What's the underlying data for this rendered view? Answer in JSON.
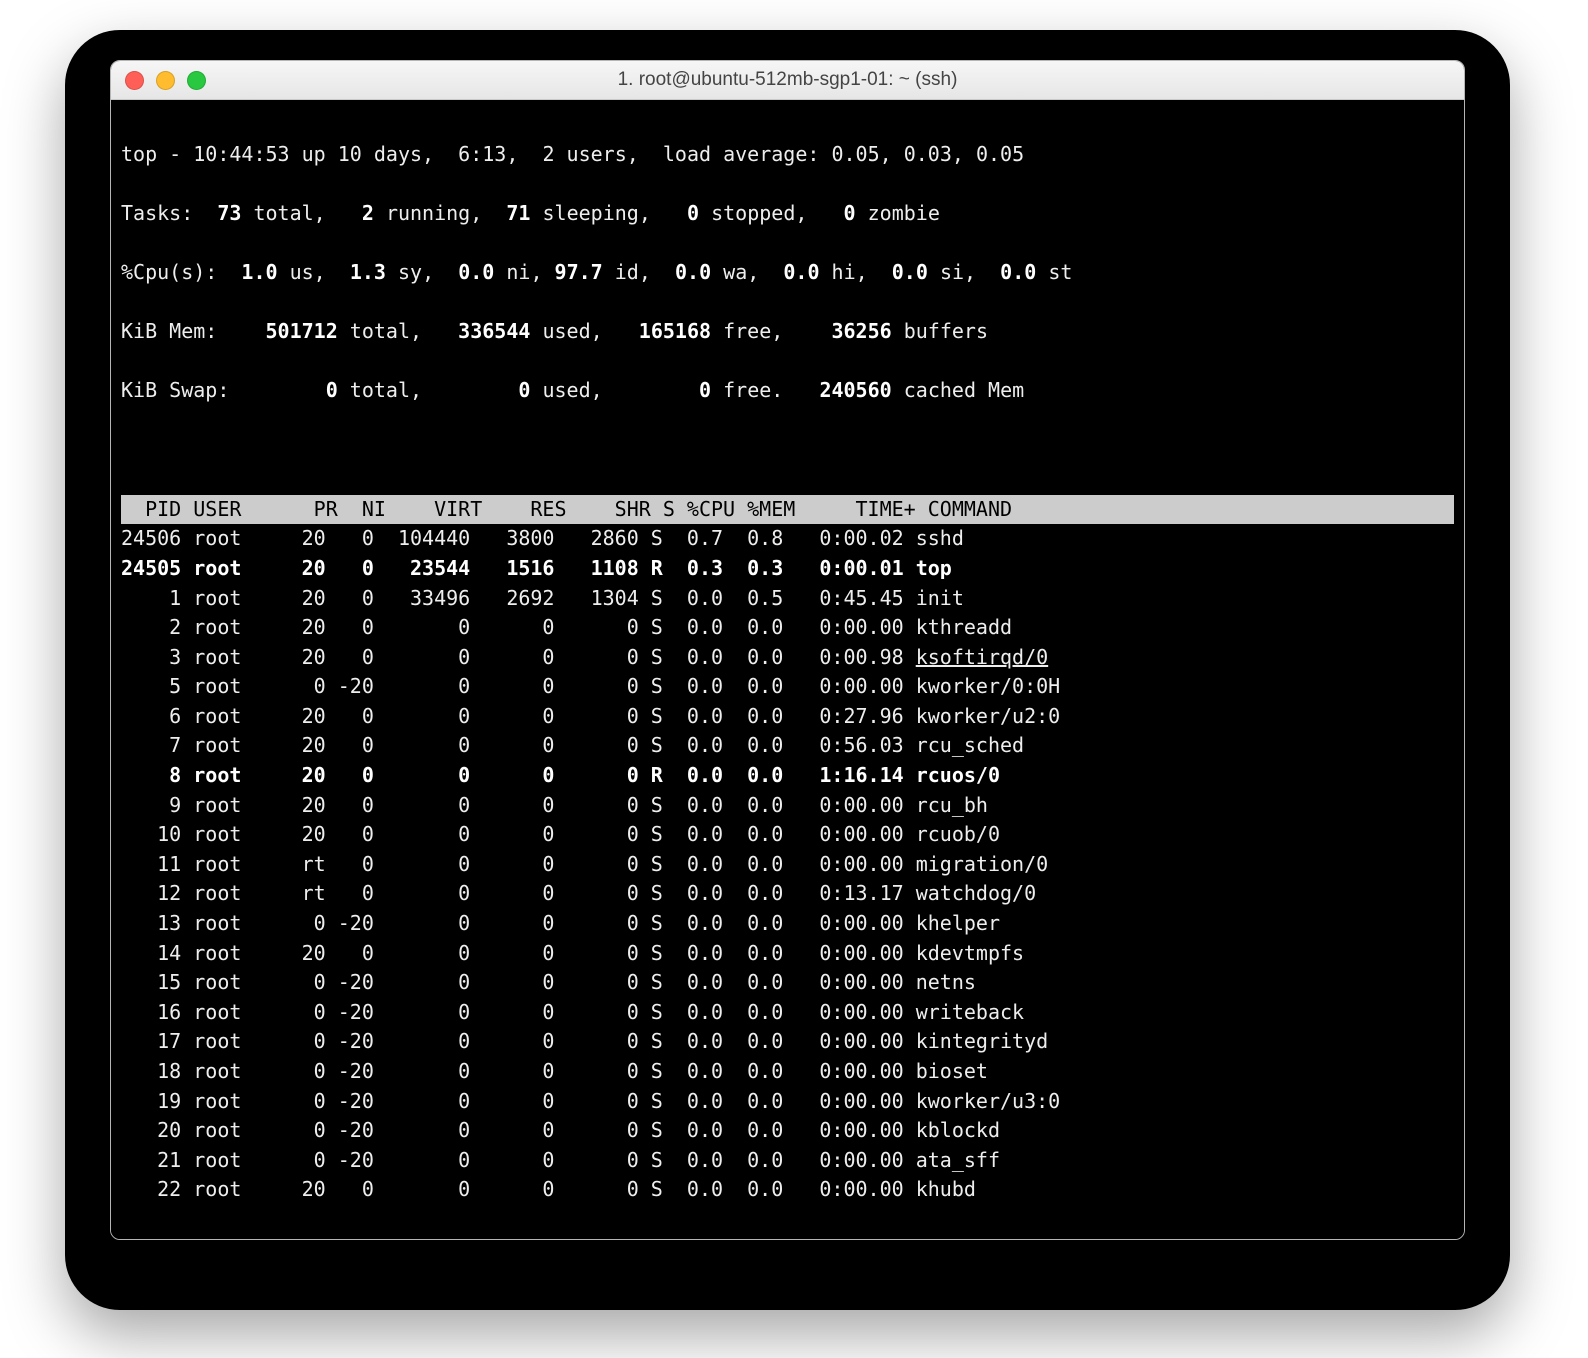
{
  "window": {
    "title": "1. root@ubuntu-512mb-sgp1-01: ~ (ssh)"
  },
  "summary": {
    "prefix": "top - ",
    "time": "10:44:53",
    "uptime_label": " up 10 days,  6:13,  ",
    "users": "2 users",
    "load_label": ",  load average: ",
    "load": "0.05, 0.03, 0.05",
    "tasks_label": "Tasks: ",
    "tasks_total": " 73 ",
    "tasks_total_suffix": "total,   ",
    "tasks_running": "2 ",
    "tasks_running_suffix": "running,  ",
    "tasks_sleeping": "71 ",
    "tasks_sleeping_suffix": "sleeping,   ",
    "tasks_stopped": "0 ",
    "tasks_stopped_suffix": "stopped,   ",
    "tasks_zombie": "0 ",
    "tasks_zombie_suffix": "zombie",
    "cpu_label": "%Cpu(s):  ",
    "cpu_us": "1.0 ",
    "cpu_us_s": "us,  ",
    "cpu_sy": "1.3 ",
    "cpu_sy_s": "sy,  ",
    "cpu_ni": "0.0 ",
    "cpu_ni_s": "ni, ",
    "cpu_id": "97.7 ",
    "cpu_id_s": "id,  ",
    "cpu_wa": "0.0 ",
    "cpu_wa_s": "wa,  ",
    "cpu_hi": "0.0 ",
    "cpu_hi_s": "hi,  ",
    "cpu_si": "0.0 ",
    "cpu_si_s": "si,  ",
    "cpu_st": "0.0 ",
    "cpu_st_s": "st",
    "mem_label": "KiB Mem:    ",
    "mem_total": "501712 ",
    "mem_total_s": "total,   ",
    "mem_used": "336544 ",
    "mem_used_s": "used,   ",
    "mem_free": "165168 ",
    "mem_free_s": "free,    ",
    "mem_buffers": "36256 ",
    "mem_buffers_s": "buffers",
    "swap_label": "KiB Swap:        ",
    "swap_total": "0 ",
    "swap_total_s": "total,        ",
    "swap_used": "0 ",
    "swap_used_s": "used,        ",
    "swap_free": "0 ",
    "swap_free_s": "free.   ",
    "swap_cached": "240560 ",
    "swap_cached_s": "cached Mem"
  },
  "columns": "  PID USER      PR  NI    VIRT    RES    SHR S %CPU %MEM     TIME+ COMMAND              ",
  "rows": [
    {
      "pid": "24506",
      "user": "root",
      "pr": "20",
      "ni": "0",
      "virt": "104440",
      "res": "3800",
      "shr": "2860",
      "s": "S",
      "cpu": "0.7",
      "mem": "0.8",
      "time": "0:00.02",
      "cmd": "sshd",
      "bold": false,
      "underline": false
    },
    {
      "pid": "24505",
      "user": "root",
      "pr": "20",
      "ni": "0",
      "virt": "23544",
      "res": "1516",
      "shr": "1108",
      "s": "R",
      "cpu": "0.3",
      "mem": "0.3",
      "time": "0:00.01",
      "cmd": "top",
      "bold": true,
      "underline": false
    },
    {
      "pid": "1",
      "user": "root",
      "pr": "20",
      "ni": "0",
      "virt": "33496",
      "res": "2692",
      "shr": "1304",
      "s": "S",
      "cpu": "0.0",
      "mem": "0.5",
      "time": "0:45.45",
      "cmd": "init",
      "bold": false,
      "underline": false
    },
    {
      "pid": "2",
      "user": "root",
      "pr": "20",
      "ni": "0",
      "virt": "0",
      "res": "0",
      "shr": "0",
      "s": "S",
      "cpu": "0.0",
      "mem": "0.0",
      "time": "0:00.00",
      "cmd": "kthreadd",
      "bold": false,
      "underline": false
    },
    {
      "pid": "3",
      "user": "root",
      "pr": "20",
      "ni": "0",
      "virt": "0",
      "res": "0",
      "shr": "0",
      "s": "S",
      "cpu": "0.0",
      "mem": "0.0",
      "time": "0:00.98",
      "cmd": "ksoftirqd/0",
      "bold": false,
      "underline": true
    },
    {
      "pid": "5",
      "user": "root",
      "pr": "0",
      "ni": "-20",
      "virt": "0",
      "res": "0",
      "shr": "0",
      "s": "S",
      "cpu": "0.0",
      "mem": "0.0",
      "time": "0:00.00",
      "cmd": "kworker/0:0H",
      "bold": false,
      "underline": false
    },
    {
      "pid": "6",
      "user": "root",
      "pr": "20",
      "ni": "0",
      "virt": "0",
      "res": "0",
      "shr": "0",
      "s": "S",
      "cpu": "0.0",
      "mem": "0.0",
      "time": "0:27.96",
      "cmd": "kworker/u2:0",
      "bold": false,
      "underline": false
    },
    {
      "pid": "7",
      "user": "root",
      "pr": "20",
      "ni": "0",
      "virt": "0",
      "res": "0",
      "shr": "0",
      "s": "S",
      "cpu": "0.0",
      "mem": "0.0",
      "time": "0:56.03",
      "cmd": "rcu_sched",
      "bold": false,
      "underline": false
    },
    {
      "pid": "8",
      "user": "root",
      "pr": "20",
      "ni": "0",
      "virt": "0",
      "res": "0",
      "shr": "0",
      "s": "R",
      "cpu": "0.0",
      "mem": "0.0",
      "time": "1:16.14",
      "cmd": "rcuos/0",
      "bold": true,
      "underline": false
    },
    {
      "pid": "9",
      "user": "root",
      "pr": "20",
      "ni": "0",
      "virt": "0",
      "res": "0",
      "shr": "0",
      "s": "S",
      "cpu": "0.0",
      "mem": "0.0",
      "time": "0:00.00",
      "cmd": "rcu_bh",
      "bold": false,
      "underline": false
    },
    {
      "pid": "10",
      "user": "root",
      "pr": "20",
      "ni": "0",
      "virt": "0",
      "res": "0",
      "shr": "0",
      "s": "S",
      "cpu": "0.0",
      "mem": "0.0",
      "time": "0:00.00",
      "cmd": "rcuob/0",
      "bold": false,
      "underline": false
    },
    {
      "pid": "11",
      "user": "root",
      "pr": "rt",
      "ni": "0",
      "virt": "0",
      "res": "0",
      "shr": "0",
      "s": "S",
      "cpu": "0.0",
      "mem": "0.0",
      "time": "0:00.00",
      "cmd": "migration/0",
      "bold": false,
      "underline": false
    },
    {
      "pid": "12",
      "user": "root",
      "pr": "rt",
      "ni": "0",
      "virt": "0",
      "res": "0",
      "shr": "0",
      "s": "S",
      "cpu": "0.0",
      "mem": "0.0",
      "time": "0:13.17",
      "cmd": "watchdog/0",
      "bold": false,
      "underline": false
    },
    {
      "pid": "13",
      "user": "root",
      "pr": "0",
      "ni": "-20",
      "virt": "0",
      "res": "0",
      "shr": "0",
      "s": "S",
      "cpu": "0.0",
      "mem": "0.0",
      "time": "0:00.00",
      "cmd": "khelper",
      "bold": false,
      "underline": false
    },
    {
      "pid": "14",
      "user": "root",
      "pr": "20",
      "ni": "0",
      "virt": "0",
      "res": "0",
      "shr": "0",
      "s": "S",
      "cpu": "0.0",
      "mem": "0.0",
      "time": "0:00.00",
      "cmd": "kdevtmpfs",
      "bold": false,
      "underline": false
    },
    {
      "pid": "15",
      "user": "root",
      "pr": "0",
      "ni": "-20",
      "virt": "0",
      "res": "0",
      "shr": "0",
      "s": "S",
      "cpu": "0.0",
      "mem": "0.0",
      "time": "0:00.00",
      "cmd": "netns",
      "bold": false,
      "underline": false
    },
    {
      "pid": "16",
      "user": "root",
      "pr": "0",
      "ni": "-20",
      "virt": "0",
      "res": "0",
      "shr": "0",
      "s": "S",
      "cpu": "0.0",
      "mem": "0.0",
      "time": "0:00.00",
      "cmd": "writeback",
      "bold": false,
      "underline": false
    },
    {
      "pid": "17",
      "user": "root",
      "pr": "0",
      "ni": "-20",
      "virt": "0",
      "res": "0",
      "shr": "0",
      "s": "S",
      "cpu": "0.0",
      "mem": "0.0",
      "time": "0:00.00",
      "cmd": "kintegrityd",
      "bold": false,
      "underline": false
    },
    {
      "pid": "18",
      "user": "root",
      "pr": "0",
      "ni": "-20",
      "virt": "0",
      "res": "0",
      "shr": "0",
      "s": "S",
      "cpu": "0.0",
      "mem": "0.0",
      "time": "0:00.00",
      "cmd": "bioset",
      "bold": false,
      "underline": false
    },
    {
      "pid": "19",
      "user": "root",
      "pr": "0",
      "ni": "-20",
      "virt": "0",
      "res": "0",
      "shr": "0",
      "s": "S",
      "cpu": "0.0",
      "mem": "0.0",
      "time": "0:00.00",
      "cmd": "kworker/u3:0",
      "bold": false,
      "underline": false
    },
    {
      "pid": "20",
      "user": "root",
      "pr": "0",
      "ni": "-20",
      "virt": "0",
      "res": "0",
      "shr": "0",
      "s": "S",
      "cpu": "0.0",
      "mem": "0.0",
      "time": "0:00.00",
      "cmd": "kblockd",
      "bold": false,
      "underline": false
    },
    {
      "pid": "21",
      "user": "root",
      "pr": "0",
      "ni": "-20",
      "virt": "0",
      "res": "0",
      "shr": "0",
      "s": "S",
      "cpu": "0.0",
      "mem": "0.0",
      "time": "0:00.00",
      "cmd": "ata_sff",
      "bold": false,
      "underline": false
    },
    {
      "pid": "22",
      "user": "root",
      "pr": "20",
      "ni": "0",
      "virt": "0",
      "res": "0",
      "shr": "0",
      "s": "S",
      "cpu": "0.0",
      "mem": "0.0",
      "time": "0:00.00",
      "cmd": "khubd",
      "bold": false,
      "underline": false
    }
  ]
}
